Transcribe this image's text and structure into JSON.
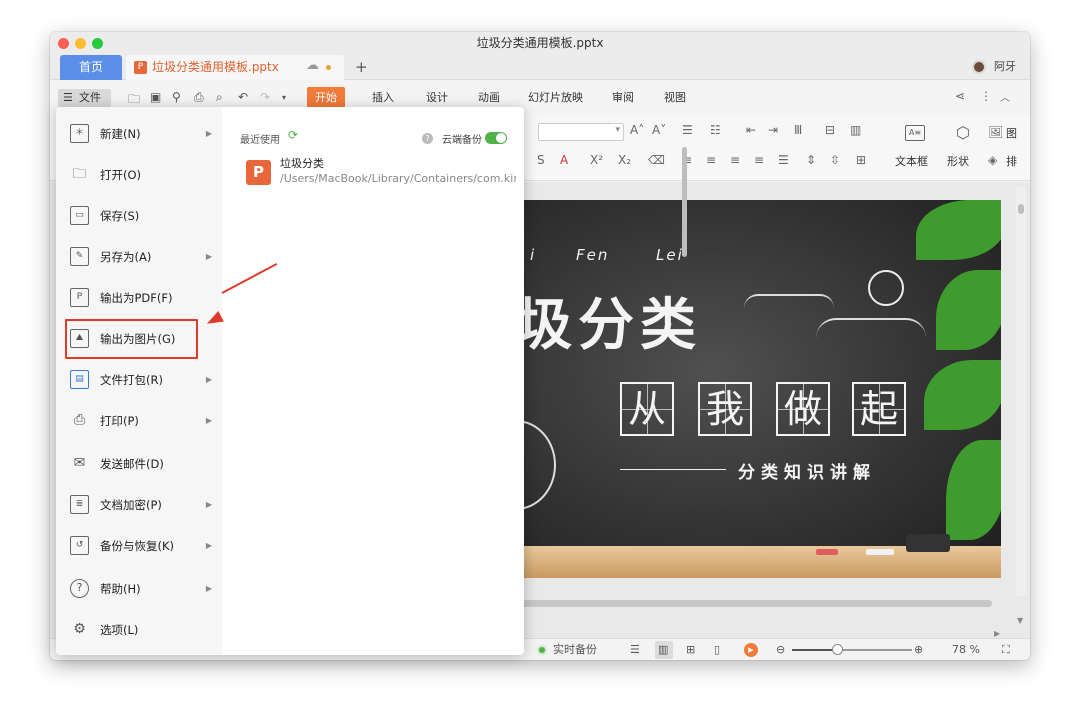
{
  "window": {
    "title": "垃圾分类通用模板.pptx"
  },
  "tabs": {
    "home_label": "首页",
    "doc_label": "垃圾分类通用模板.pptx",
    "new_tab_label": "+"
  },
  "user": {
    "name": "阿牙"
  },
  "toolbar": {
    "file_label": "文件",
    "ribbon_tabs": [
      "开始",
      "插入",
      "设计",
      "动画",
      "幻灯片放映",
      "审阅",
      "视图"
    ],
    "active_tab": "开始"
  },
  "ribbon": {
    "textbox_label": "文本框",
    "shape_label": "形状",
    "image_label": "图",
    "arrange_label": "排"
  },
  "file_menu": {
    "items": [
      {
        "label": "新建(N)",
        "icon": "new-file-icon",
        "has_submenu": true
      },
      {
        "label": "打开(O)",
        "icon": "folder-icon",
        "has_submenu": false
      },
      {
        "label": "保存(S)",
        "icon": "save-icon",
        "has_submenu": false
      },
      {
        "label": "另存为(A)",
        "icon": "save-as-icon",
        "has_submenu": true
      },
      {
        "label": "输出为PDF(F)",
        "icon": "pdf-icon",
        "has_submenu": false
      },
      {
        "label": "输出为图片(G)",
        "icon": "image-icon",
        "has_submenu": false
      },
      {
        "label": "文件打包(R)",
        "icon": "package-icon",
        "has_submenu": true
      },
      {
        "label": "打印(P)",
        "icon": "print-icon",
        "has_submenu": true
      },
      {
        "label": "发送邮件(D)",
        "icon": "mail-icon",
        "has_submenu": false
      },
      {
        "label": "文档加密(P)",
        "icon": "lock-document-icon",
        "has_submenu": true
      },
      {
        "label": "备份与恢复(K)",
        "icon": "backup-icon",
        "has_submenu": true
      },
      {
        "label": "帮助(H)",
        "icon": "help-icon",
        "has_submenu": true
      },
      {
        "label": "选项(L)",
        "icon": "gear-icon",
        "has_submenu": false
      }
    ],
    "highlighted_item": "输出为图片(G)"
  },
  "recent": {
    "title": "最近使用",
    "cloud_backup_label": "云端备份",
    "cloud_backup_on": true,
    "files": [
      {
        "name": "垃圾分类",
        "path": "/Users/MacBook/Library/Containers/com.kingsoft.wpsoffice.mac"
      }
    ]
  },
  "slide": {
    "pinyin": [
      "i",
      "Fen",
      "Lei"
    ],
    "title": "圾分类",
    "boxed_chars": [
      "从",
      "我",
      "做",
      "起"
    ],
    "subtitle": "分类知识讲解"
  },
  "statusbar": {
    "backup_label": "实时备份",
    "zoom": "78 %"
  },
  "colors": {
    "accent_orange": "#f07b3a",
    "home_tab_blue": "#5a8ee8",
    "highlight_red": "#e03a2a",
    "toggle_green": "#4fb34a"
  }
}
